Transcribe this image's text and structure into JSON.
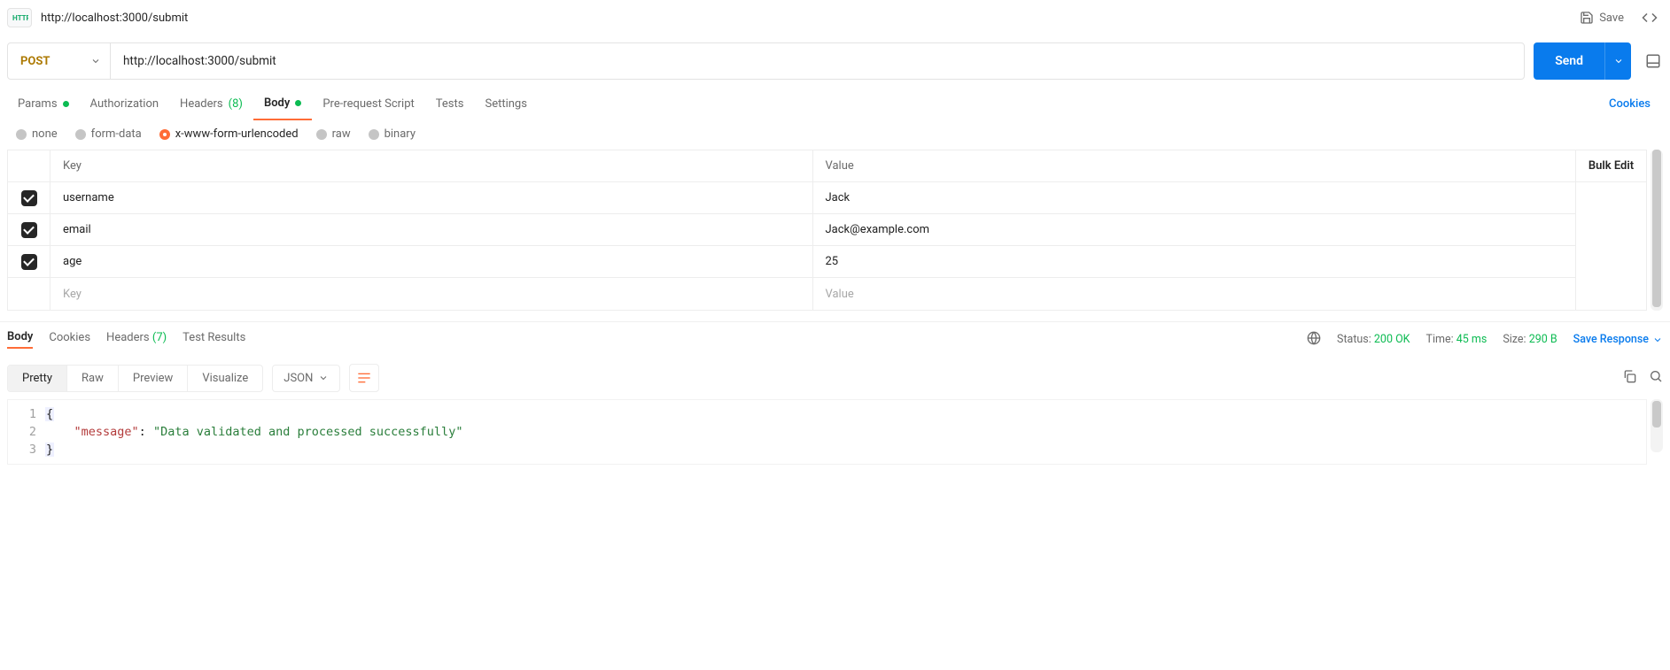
{
  "header": {
    "breadcrumb": "http://localhost:3000/submit",
    "save_label": "Save"
  },
  "request": {
    "method": "POST",
    "url": "http://localhost:3000/submit",
    "send_label": "Send"
  },
  "req_tabs": {
    "params": "Params",
    "authorization": "Authorization",
    "headers_label": "Headers",
    "headers_count": "(8)",
    "body": "Body",
    "prerequest": "Pre-request Script",
    "tests": "Tests",
    "settings": "Settings",
    "cookies": "Cookies"
  },
  "body_types": {
    "none": "none",
    "form_data": "form-data",
    "urlencoded": "x-www-form-urlencoded",
    "raw": "raw",
    "binary": "binary"
  },
  "kv": {
    "key_label": "Key",
    "value_label": "Value",
    "bulk_edit": "Bulk Edit",
    "rows": [
      {
        "checked": true,
        "key": "username",
        "value": "Jack"
      },
      {
        "checked": true,
        "key": "email",
        "value": "Jack@example.com"
      },
      {
        "checked": true,
        "key": "age",
        "value": "25"
      }
    ],
    "placeholder_key": "Key",
    "placeholder_value": "Value"
  },
  "resp_tabs": {
    "body": "Body",
    "cookies": "Cookies",
    "headers": "Headers",
    "headers_count": "(7)",
    "test_results": "Test Results"
  },
  "resp_meta": {
    "status_label": "Status:",
    "status_value": "200 OK",
    "time_label": "Time:",
    "time_value": "45 ms",
    "size_label": "Size:",
    "size_value": "290 B",
    "save_response": "Save Response"
  },
  "resp_sub": {
    "pretty": "Pretty",
    "raw": "Raw",
    "preview": "Preview",
    "visualize": "Visualize",
    "fmt": "JSON"
  },
  "resp_body": {
    "line1": "{",
    "line2_key": "\"message\"",
    "line2_sep": ":",
    "line2_val": "\"Data validated and processed successfully\"",
    "line3": "}"
  }
}
